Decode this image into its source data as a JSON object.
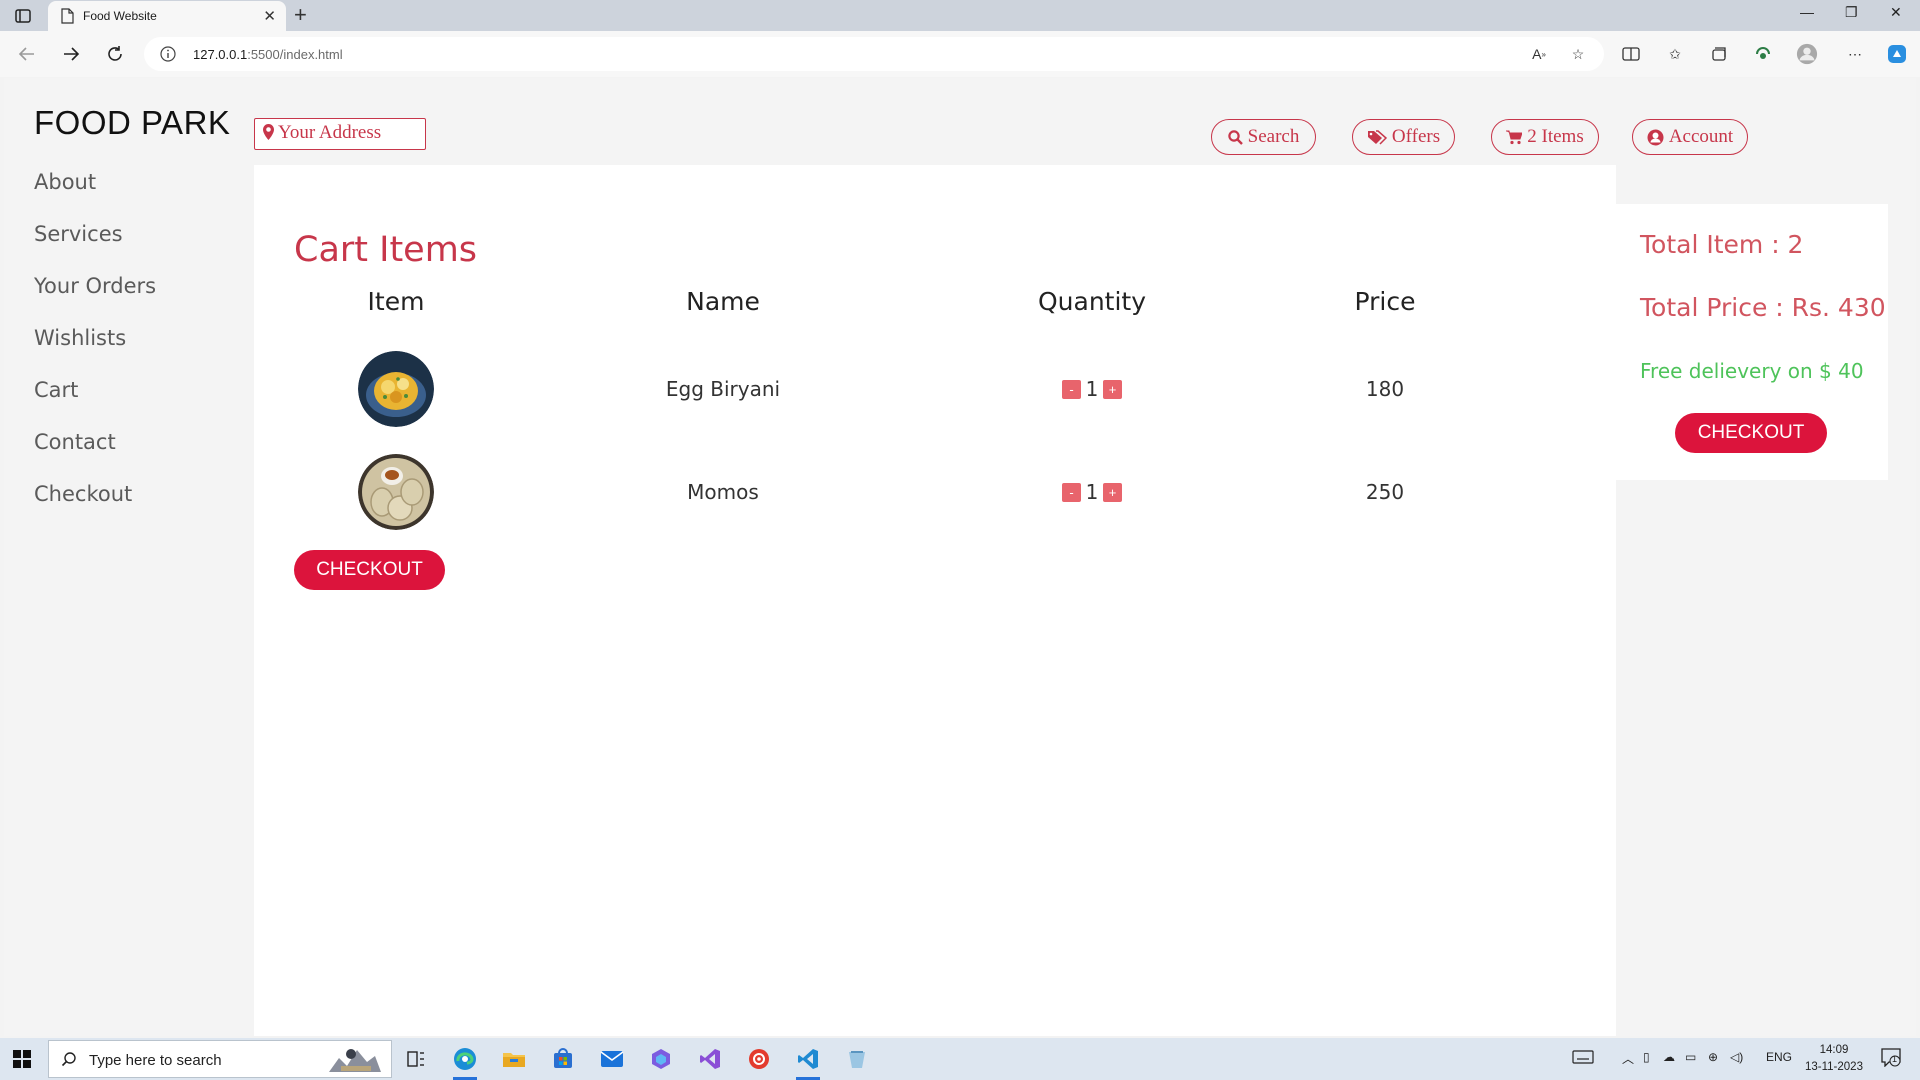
{
  "browser": {
    "tab_title": "Food Website",
    "url_host": "127.0.0.1",
    "url_path": ":5500/index.html"
  },
  "site": {
    "brand": "FOOD PARK",
    "nav": [
      "About",
      "Services",
      "Your Orders",
      "Wishlists",
      "Cart",
      "Contact",
      "Checkout"
    ],
    "address_placeholder": "Your Address",
    "header_buttons": {
      "search": "Search",
      "offers": "Offers",
      "cart": "2 Items",
      "account": "Account"
    }
  },
  "cart": {
    "title": "Cart Items",
    "columns": [
      "Item",
      "Name",
      "Quantity",
      "Price"
    ],
    "rows": [
      {
        "name": "Egg Biryani",
        "quantity": "1",
        "price": "180",
        "image": "egg-biryani-image"
      },
      {
        "name": "Momos",
        "quantity": "1",
        "price": "250",
        "image": "momos-image"
      }
    ],
    "decrement_label": "-",
    "increment_label": "+",
    "checkout_label": "CHECKOUT"
  },
  "summary": {
    "total_items": "Total Item : 2",
    "total_price": "Total Price : Rs. 430",
    "delivery_note": "Free delievery on $ 40",
    "checkout_label": "CHECKOUT"
  },
  "taskbar": {
    "search_placeholder": "Type here to search",
    "language": "ENG",
    "time": "14:09",
    "date": "13-11-2023",
    "notification_count": "1"
  },
  "colors": {
    "accent": "#dc143c",
    "accent_text": "#c7364a",
    "free_delivery": "#4ec35a"
  }
}
